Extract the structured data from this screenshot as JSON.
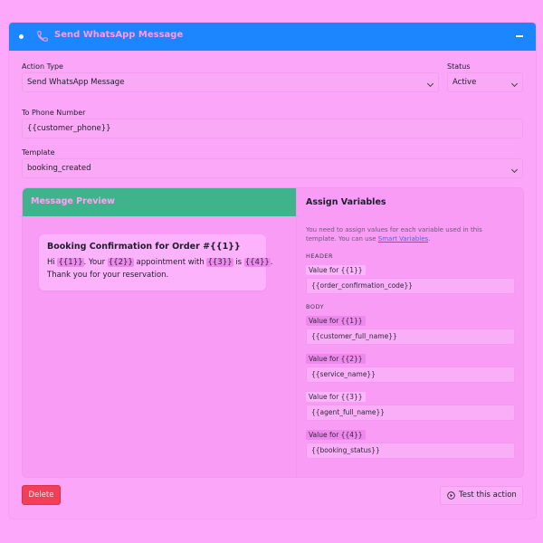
{
  "header": {
    "title": "Send WhatsApp Message",
    "icon": "phone-icon"
  },
  "form": {
    "action_type": {
      "label": "Action Type",
      "value": "Send WhatsApp Message"
    },
    "status": {
      "label": "Status",
      "value": "Active"
    },
    "to_phone": {
      "label": "To Phone Number",
      "value": "{{customer_phone}}"
    },
    "template": {
      "label": "Template",
      "value": "booking_created"
    }
  },
  "preview": {
    "heading": "Message Preview",
    "title": "Booking Confirmation for Order #{{1}}",
    "line1": {
      "p0": "Hi ",
      "c1": "{{1}}",
      "p1": ". Your ",
      "c2": "{{2}}",
      "p2": " appointment with ",
      "c3": "{{3}}",
      "p3": " is ",
      "c4": "{{4}}",
      "p4": "."
    },
    "line2": "Thank you for your reservation."
  },
  "assign": {
    "heading": "Assign Variables",
    "desc_before": "You need to assign values for each variable used in this template. You can use ",
    "link": "Smart Variables",
    "desc_after": ".",
    "header_section": "HEADER",
    "body_section": "BODY",
    "header_vars": [
      {
        "label": "Value for {{1}}",
        "value": "{{order_confirmation_code}}"
      }
    ],
    "body_vars": [
      {
        "label": "Value for {{1}}",
        "value": "{{customer_full_name}}"
      },
      {
        "label": "Value for {{2}}",
        "value": "{{service_name}}"
      },
      {
        "label": "Value for {{3}}",
        "value": "{{agent_full_name}}"
      },
      {
        "label": "Value for {{4}}",
        "value": "{{booking_status}}"
      }
    ]
  },
  "buttons": {
    "delete": "Delete",
    "test": "Test this action"
  },
  "colors": {
    "header_bar": "#1b86ff",
    "preview_header": "#3fb48c",
    "delete_button": "#f23f58",
    "variable_chip": "#ef88ec",
    "link": "#3d6fd8"
  }
}
